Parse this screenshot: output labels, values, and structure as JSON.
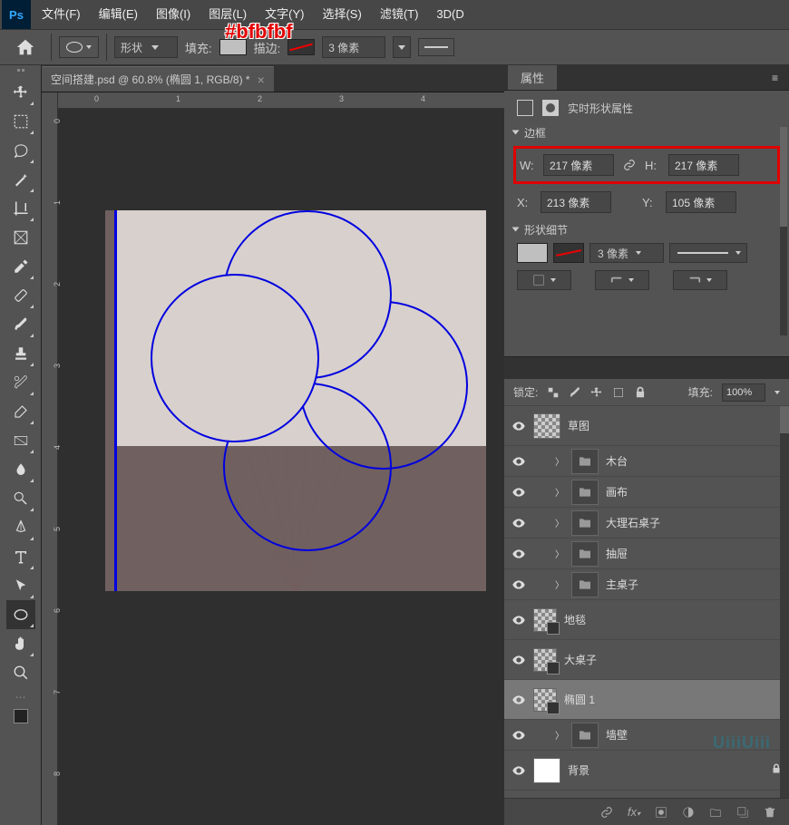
{
  "annotation": "#bfbfbf",
  "menubar": {
    "items": [
      "文件(F)",
      "编辑(E)",
      "图像(I)",
      "图层(L)",
      "文字(Y)",
      "选择(S)",
      "滤镜(T)",
      "3D(D"
    ]
  },
  "optbar": {
    "mode": "形状",
    "fill_label": "填充:",
    "stroke_label": "描边:",
    "stroke_width": "3 像素"
  },
  "doc_tab": "空间搭建.psd @ 60.8% (椭圆 1, RGB/8) *",
  "ruler_h": [
    "0",
    "1",
    "2",
    "3",
    "4"
  ],
  "ruler_v": [
    "0",
    "1",
    "2",
    "3",
    "4",
    "5",
    "6",
    "7",
    "8"
  ],
  "props": {
    "title": "属性",
    "subtitle": "实时形状属性",
    "section_frame": "边框",
    "w_label": "W:",
    "w_value": "217 像素",
    "h_label": "H:",
    "h_value": "217 像素",
    "x_label": "X:",
    "x_value": "213 像素",
    "y_label": "Y:",
    "y_value": "105 像素",
    "section_detail": "形状细节",
    "stroke_value": "3 像素"
  },
  "layers": {
    "lock_label": "锁定:",
    "fill_label": "填充:",
    "fill_value": "100%",
    "items": [
      {
        "name": "草图",
        "type": "thumb",
        "checker": true,
        "tall": true
      },
      {
        "name": "木台",
        "type": "folder"
      },
      {
        "name": "画布",
        "type": "folder"
      },
      {
        "name": "大理石桌子",
        "type": "folder"
      },
      {
        "name": "抽屉",
        "type": "folder"
      },
      {
        "name": "主桌子",
        "type": "folder"
      },
      {
        "name": "地毯",
        "type": "double",
        "tall": true
      },
      {
        "name": "大桌子",
        "type": "double",
        "tall": true
      },
      {
        "name": "椭圆 1",
        "type": "double",
        "tall": true,
        "sel": true
      },
      {
        "name": "墙壁",
        "type": "folder"
      },
      {
        "name": "背景",
        "type": "thumb",
        "white": true,
        "locked": true,
        "tall": true
      }
    ]
  },
  "watermark": "UiiiUiii"
}
